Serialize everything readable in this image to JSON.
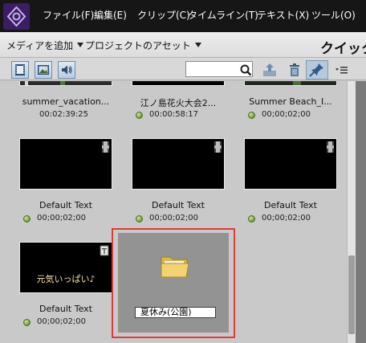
{
  "app": {
    "logo_icon": "premiere-elements-logo-icon",
    "accent_color": "#3a1d63"
  },
  "menu": {
    "items": [
      "ファイル(F)",
      "編集(E)",
      "クリップ(C)",
      "タイムライン(T)",
      "テキスト(X)",
      "ツール(O)"
    ]
  },
  "toolbar": {
    "add_media_label": "メディアを追加",
    "project_assets_label": "プロジェクトのアセット",
    "quick_label": "クイック"
  },
  "filters": {
    "icons": [
      "video-filter-icon",
      "image-filter-icon",
      "audio-filter-icon"
    ],
    "search": {
      "value": "",
      "placeholder": ""
    },
    "tool_icons": [
      "search-icon",
      "upload-icon",
      "trash-icon",
      "pin-icon",
      "panel-menu-icon"
    ]
  },
  "clips": [
    {
      "name": "summer_vacation...",
      "duration": "00:02:39:25",
      "has_status": false
    },
    {
      "name": "江ノ島花火大会2...",
      "duration": "00:00:58:17",
      "has_status": true
    },
    {
      "name": "Summer Beach_I...",
      "duration": "00;00;02;00",
      "has_status": true
    },
    {
      "name": "Default Text",
      "duration": "00;00;02;00",
      "has_status": true
    },
    {
      "name": "Default Text",
      "duration": "00;00;02;00",
      "has_status": true
    },
    {
      "name": "Default Text",
      "duration": "00;00;02;00",
      "has_status": true
    },
    {
      "name": "Default Text",
      "duration": "00;00;02;00",
      "has_status": true,
      "thumb_caption": "元気いっぱい♪"
    }
  ],
  "folder": {
    "name": "夏休み(公園)",
    "icon": "folder-icon",
    "selected": true,
    "highlight_color": "#e13b33"
  }
}
